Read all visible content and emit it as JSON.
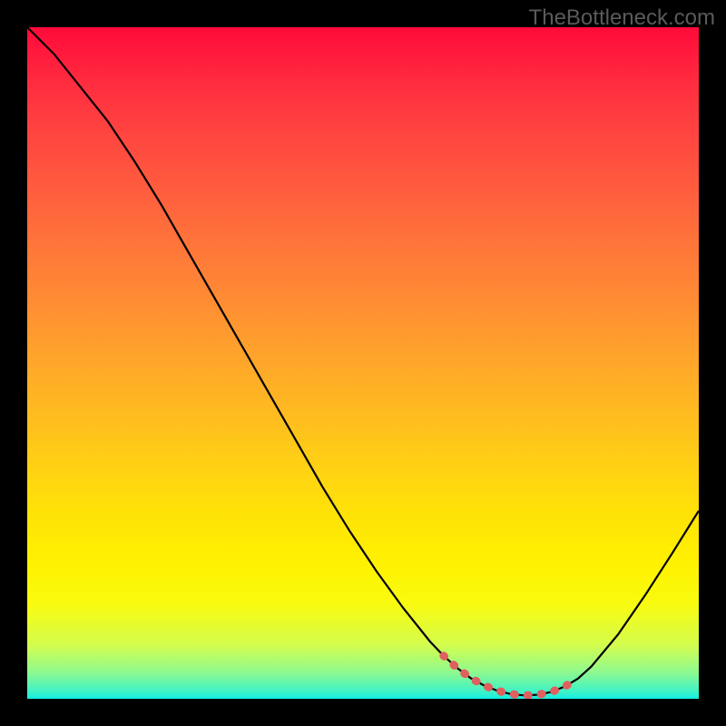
{
  "watermark": "TheBottleneck.com",
  "colors": {
    "curve": "#000000",
    "sweet_spot": "#e06060",
    "gradient_top": "#ff0a3a",
    "gradient_bottom": "#13eee6",
    "page_bg": "#000000"
  },
  "chart_data": {
    "type": "line",
    "title": "",
    "xlabel": "",
    "ylabel": "",
    "xlim": [
      0,
      100
    ],
    "ylim": [
      0,
      100
    ],
    "grid": false,
    "legend": false,
    "description": "Bottleneck curve. Y axis = bottleneck percentage (100 at top, 0 at bottom). X axis = relative hardware balance 0–100. Black line is the curve; salmon dotted segment marks the low-bottleneck sweet spot near the trough.",
    "series": [
      {
        "name": "bottleneck",
        "x": [
          0,
          4,
          8,
          12,
          16,
          20,
          24,
          28,
          32,
          36,
          40,
          44,
          48,
          52,
          56,
          60,
          62,
          64,
          66,
          68,
          70,
          72,
          74,
          76,
          78,
          80,
          82,
          84,
          88,
          92,
          96,
          100
        ],
        "y": [
          100,
          96,
          91,
          86,
          80,
          73.5,
          66.5,
          59.5,
          52.5,
          45.5,
          38.5,
          31.5,
          25,
          19,
          13.5,
          8.5,
          6.4,
          4.6,
          3.1,
          2.0,
          1.2,
          0.7,
          0.5,
          0.6,
          1.0,
          1.8,
          3.0,
          4.8,
          9.6,
          15.4,
          21.6,
          28
        ]
      }
    ],
    "sweet_spot": {
      "x": [
        62,
        64,
        66,
        68,
        70,
        72,
        74,
        76,
        78,
        80,
        82
      ],
      "y": [
        6.4,
        4.6,
        3.1,
        2.0,
        1.2,
        0.7,
        0.5,
        0.6,
        1.0,
        1.8,
        3.0
      ]
    }
  }
}
